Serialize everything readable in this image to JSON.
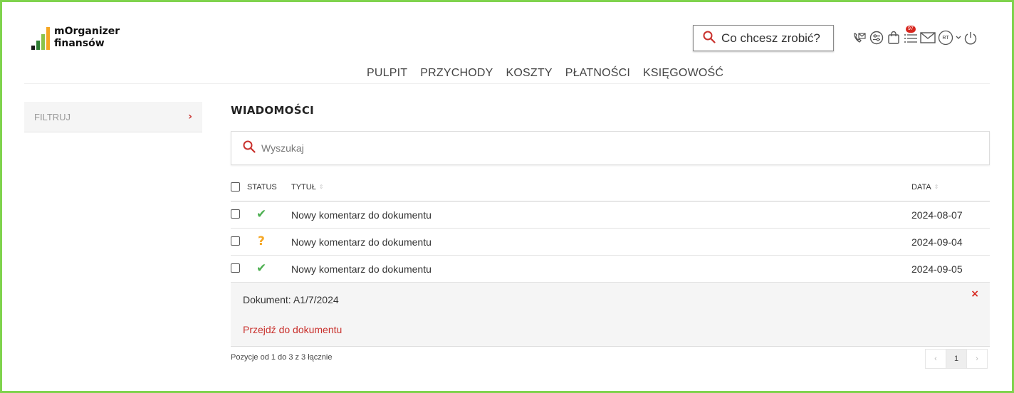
{
  "app": {
    "logo_line1": "mOrganizer",
    "logo_line2": "finansów"
  },
  "header": {
    "search_label": "Co chcesz zrobić?",
    "notification_count": "97",
    "user_initials": "RT",
    "icons": [
      "phone-mail-icon",
      "settings-circle-icon",
      "shopping-bag-icon",
      "list-icon",
      "mail-icon",
      "user-avatar-icon",
      "chevron-down-icon",
      "power-icon"
    ]
  },
  "nav": {
    "items": [
      "PULPIT",
      "PRZYCHODY",
      "KOSZTY",
      "PŁATNOŚCI",
      "KSIĘGOWOŚĆ"
    ]
  },
  "sidebar": {
    "filter_label": "FILTRUJ"
  },
  "main": {
    "title": "WIADOMOŚCI",
    "search_placeholder": "Wyszukaj",
    "columns": {
      "status": "STATUS",
      "title": "TYTUŁ",
      "date": "DATA"
    },
    "rows": [
      {
        "status": "read",
        "status_glyph": "✔",
        "title": "Nowy komentarz do dokumentu",
        "date": "2024-08-07"
      },
      {
        "status": "unread",
        "status_glyph": "?",
        "title": "Nowy komentarz do dokumentu",
        "date": "2024-09-04"
      },
      {
        "status": "read",
        "status_glyph": "✔",
        "title": "Nowy komentarz do dokumentu",
        "date": "2024-09-05"
      }
    ],
    "detail": {
      "document": "Dokument: A1/7/2024",
      "link": "Przejdź do dokumentu",
      "close": "×"
    },
    "footer_info": "Pozycje od 1 do 3 z 3 łącznie",
    "pagination": {
      "prev": "‹",
      "current": "1",
      "next": "›"
    }
  },
  "colors": {
    "accent": "#c9302c",
    "success": "#4caf50",
    "warning": "#f5a623",
    "frame": "#7fd34d"
  }
}
